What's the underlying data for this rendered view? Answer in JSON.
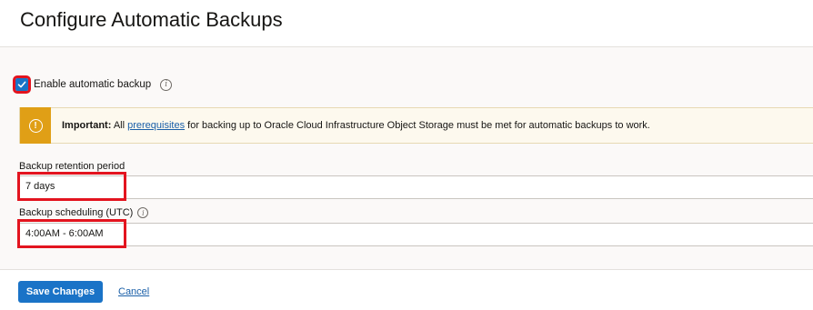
{
  "dialog": {
    "title": "Configure Automatic Backups"
  },
  "enable_backup": {
    "label": "Enable automatic backup",
    "checked": true
  },
  "notice": {
    "strong": "Important:",
    "prefix": " All ",
    "link": "prerequisites",
    "suffix": " for backing up to Oracle Cloud Infrastructure Object Storage must be met for automatic backups to work.",
    "icon": "warning-icon",
    "color": "#e09f16"
  },
  "retention": {
    "label": "Backup retention period",
    "value": "7 days"
  },
  "scheduling": {
    "label": "Backup scheduling (UTC)",
    "value": "4:00AM - 6:00AM"
  },
  "footer": {
    "save_label": "Save Changes",
    "cancel_label": "Cancel"
  },
  "colors": {
    "primary": "#1a73c7",
    "highlight": "#e3141f"
  }
}
